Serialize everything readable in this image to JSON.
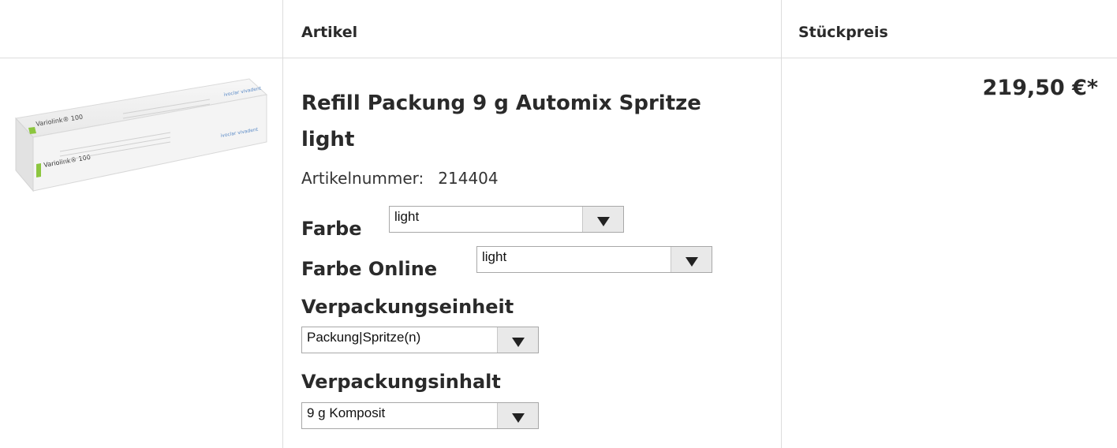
{
  "header": {
    "col_article": "Artikel",
    "col_unit_price": "Stückpreis"
  },
  "product": {
    "image_alt": "Variolink 100 product box",
    "box_text_brand": "Variolink® 100",
    "box_text_company": "ivoclar vivadent",
    "title": "Refill Packung 9 g Automix Spritze light",
    "article_number_label": "Artikelnummer:",
    "article_number": "214404",
    "price": "219,50 €*"
  },
  "options": [
    {
      "label": "Farbe",
      "value": "light"
    },
    {
      "label": "Farbe Online",
      "value": "light"
    },
    {
      "label": "Verpackungseinheit",
      "value": "Packung|Spritze(n)"
    },
    {
      "label": "Verpackungsinhalt",
      "value": "9 g Komposit"
    }
  ],
  "colors": {
    "border": "#dcdcdc",
    "box_accent": "#8cc63f"
  }
}
